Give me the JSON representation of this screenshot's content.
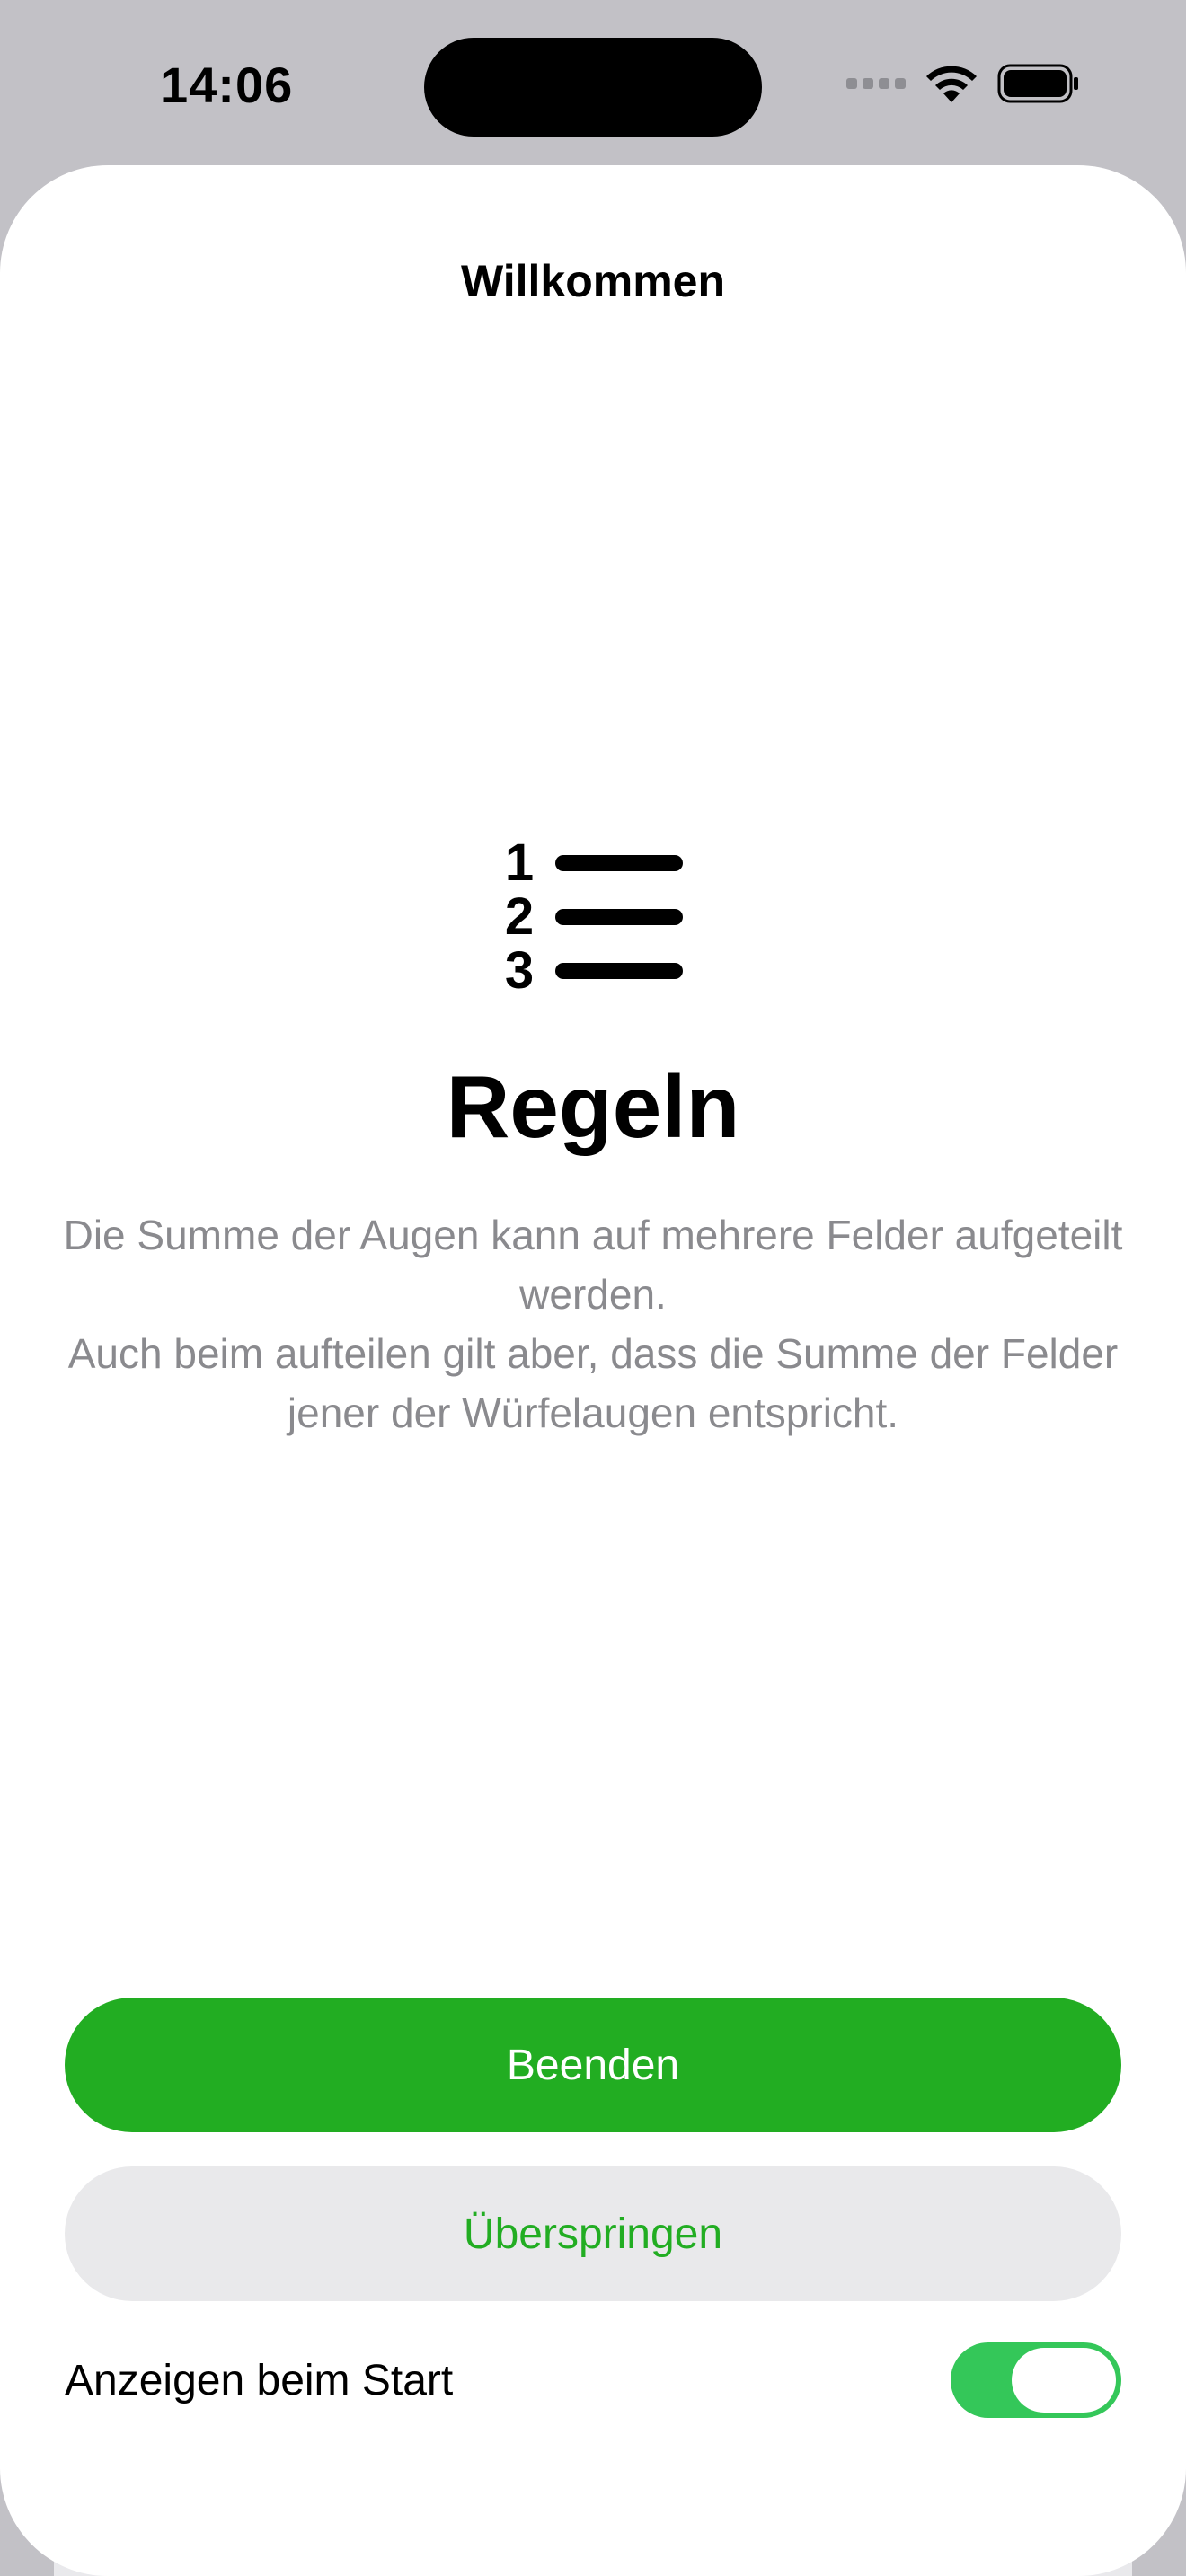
{
  "status_bar": {
    "time": "14:06",
    "icons": [
      "cellular-signal-icon",
      "wifi-icon",
      "battery-icon"
    ]
  },
  "sheet": {
    "title": "Willkommen",
    "icon": "numbered-list-icon",
    "heading": "Regeln",
    "description_lines": [
      "Die Summe der Augen kann auf mehrere Felder aufgeteilt werden.",
      "Auch beim aufteilen gilt aber, dass die Summe der Felder jener der Würfelaugen entspricht."
    ],
    "primary_button": "Beenden",
    "secondary_button": "Überspringen",
    "toggle": {
      "label": "Anzeigen beim Start",
      "on": true
    }
  },
  "colors": {
    "accent": "#22ad22",
    "toggle_on": "#34c759",
    "secondary_button_bg": "#e9e9eb",
    "description_text": "#8a8a8e"
  }
}
